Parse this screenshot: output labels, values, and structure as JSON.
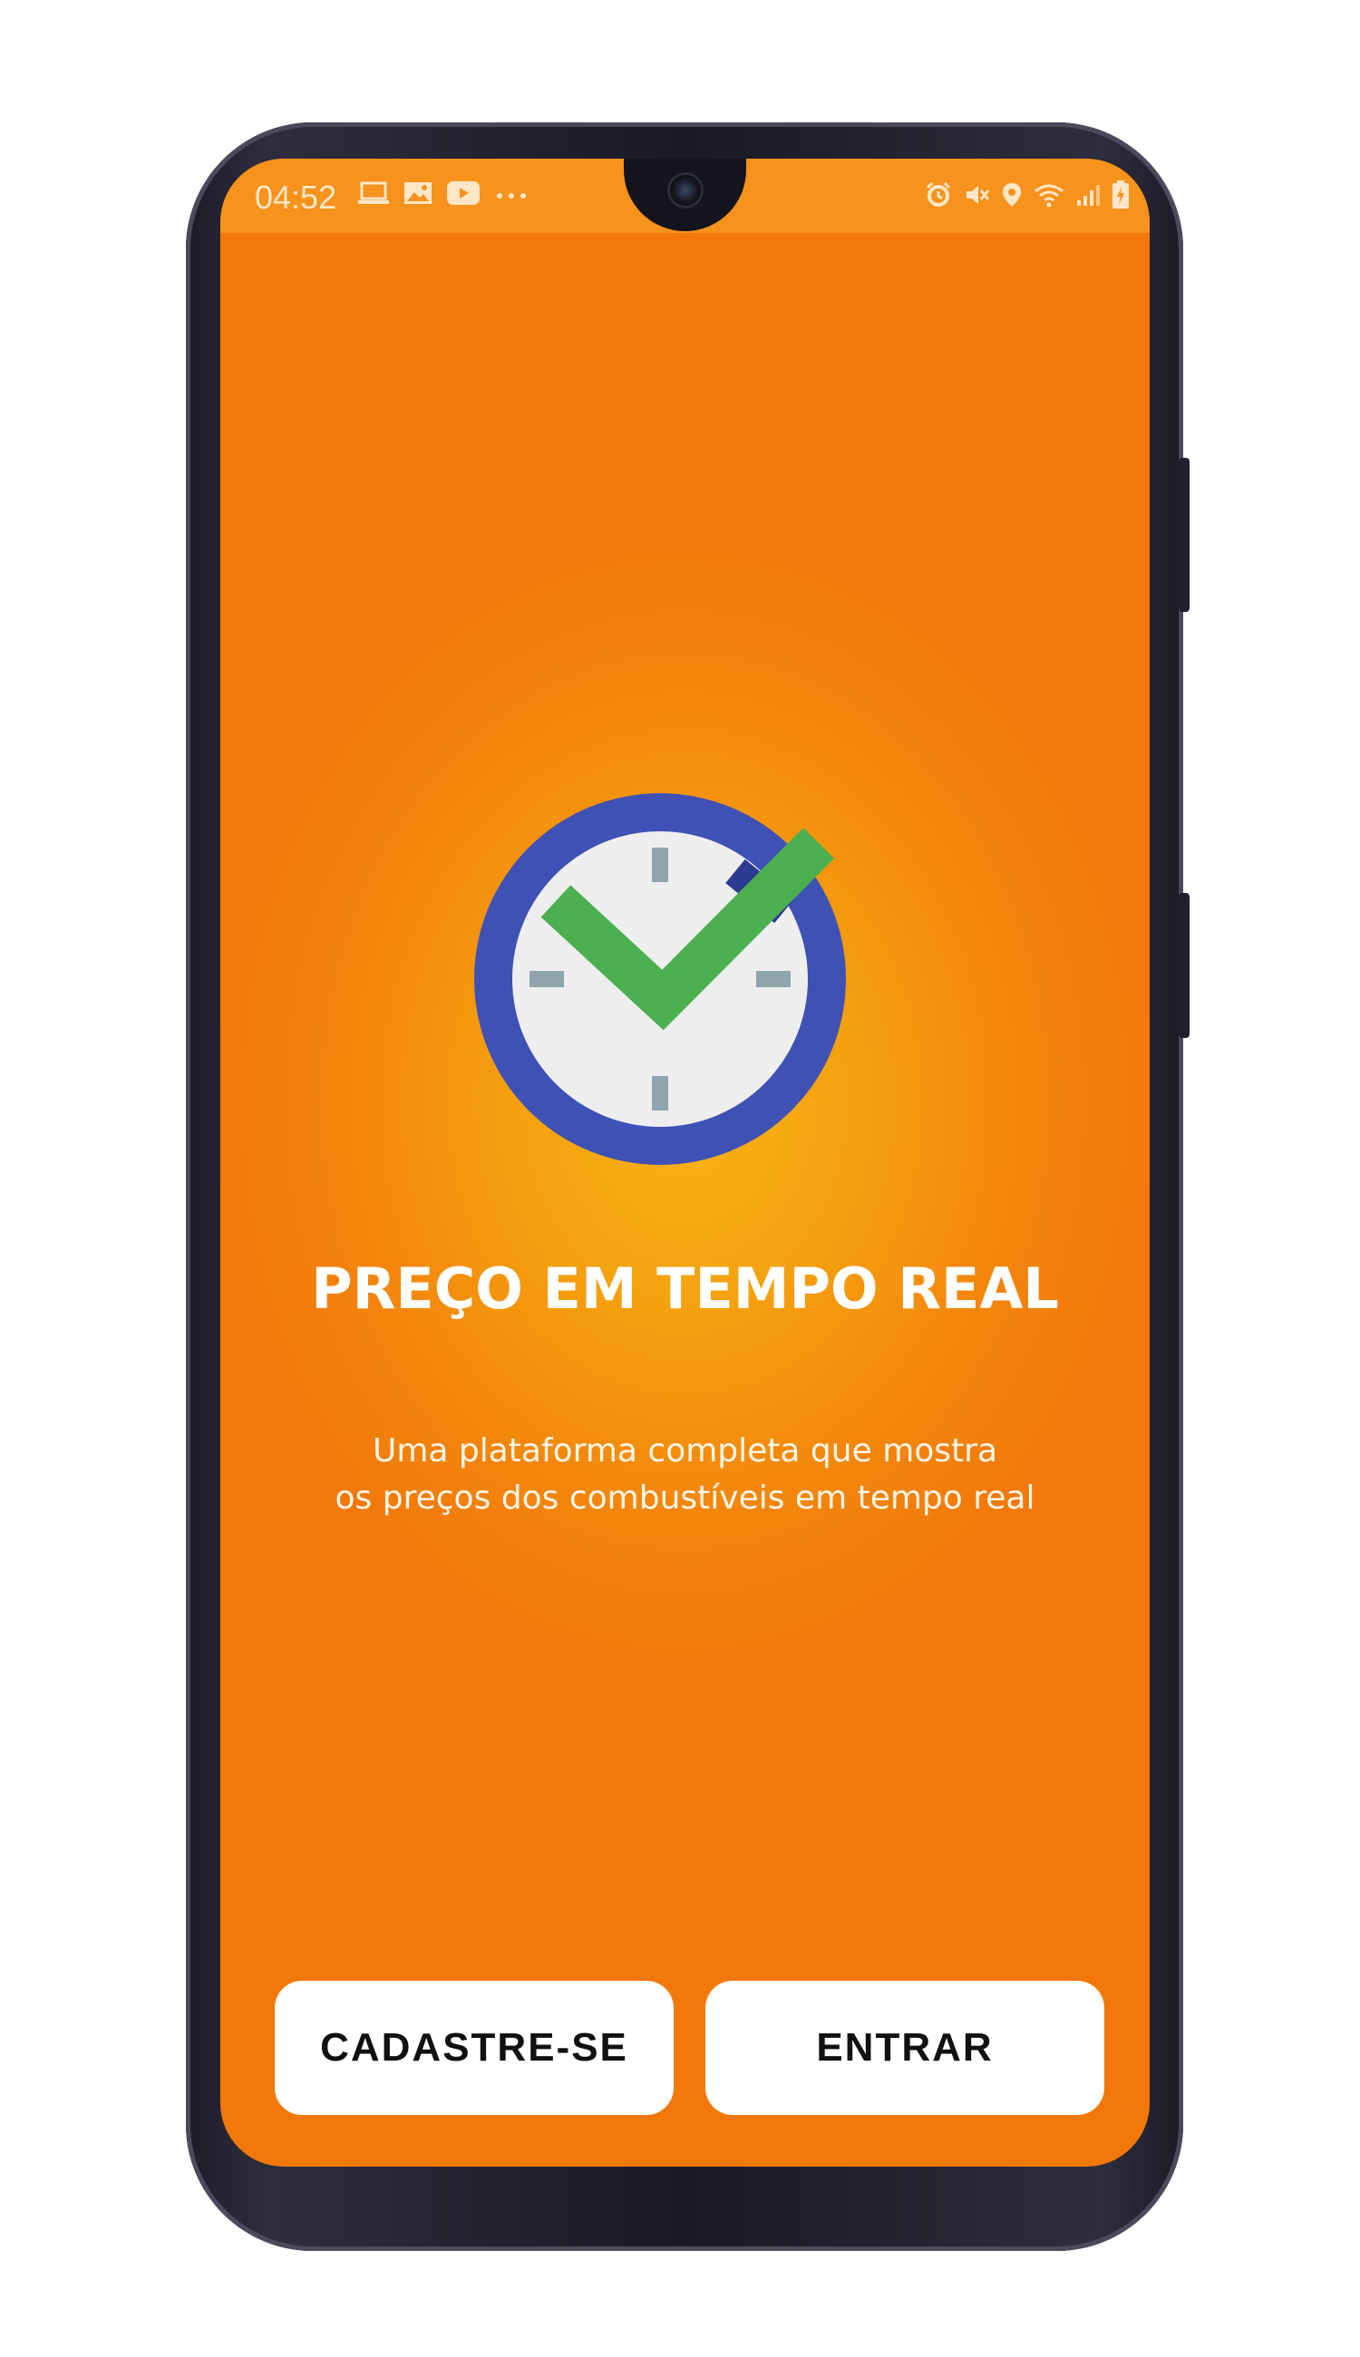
{
  "status_bar": {
    "time": "04:52",
    "left_icons": [
      "laptop-icon",
      "image-icon",
      "youtube-icon",
      "more-dots-icon"
    ],
    "right_icons": [
      "alarm-icon",
      "mute-icon",
      "location-icon",
      "wifi-icon",
      "signal-icon",
      "battery-icon"
    ]
  },
  "hero": {
    "icon": "clock-check-icon",
    "colors": {
      "ring": "#3f51b5",
      "face": "#eeeeee",
      "ticks": "#90a4ae",
      "check": "#4caf50"
    }
  },
  "main": {
    "title": "PREÇO EM TEMPO REAL",
    "subtitle_line1": "Uma plataforma completa que mostra",
    "subtitle_line2": "os preços dos combustíveis em tempo real"
  },
  "actions": {
    "signup_label": "CADASTRE-SE",
    "enter_label": "ENTRAR"
  },
  "colors": {
    "background_center": "#f6b412",
    "background_edge": "#f2780a",
    "button_bg": "#ffffff"
  }
}
